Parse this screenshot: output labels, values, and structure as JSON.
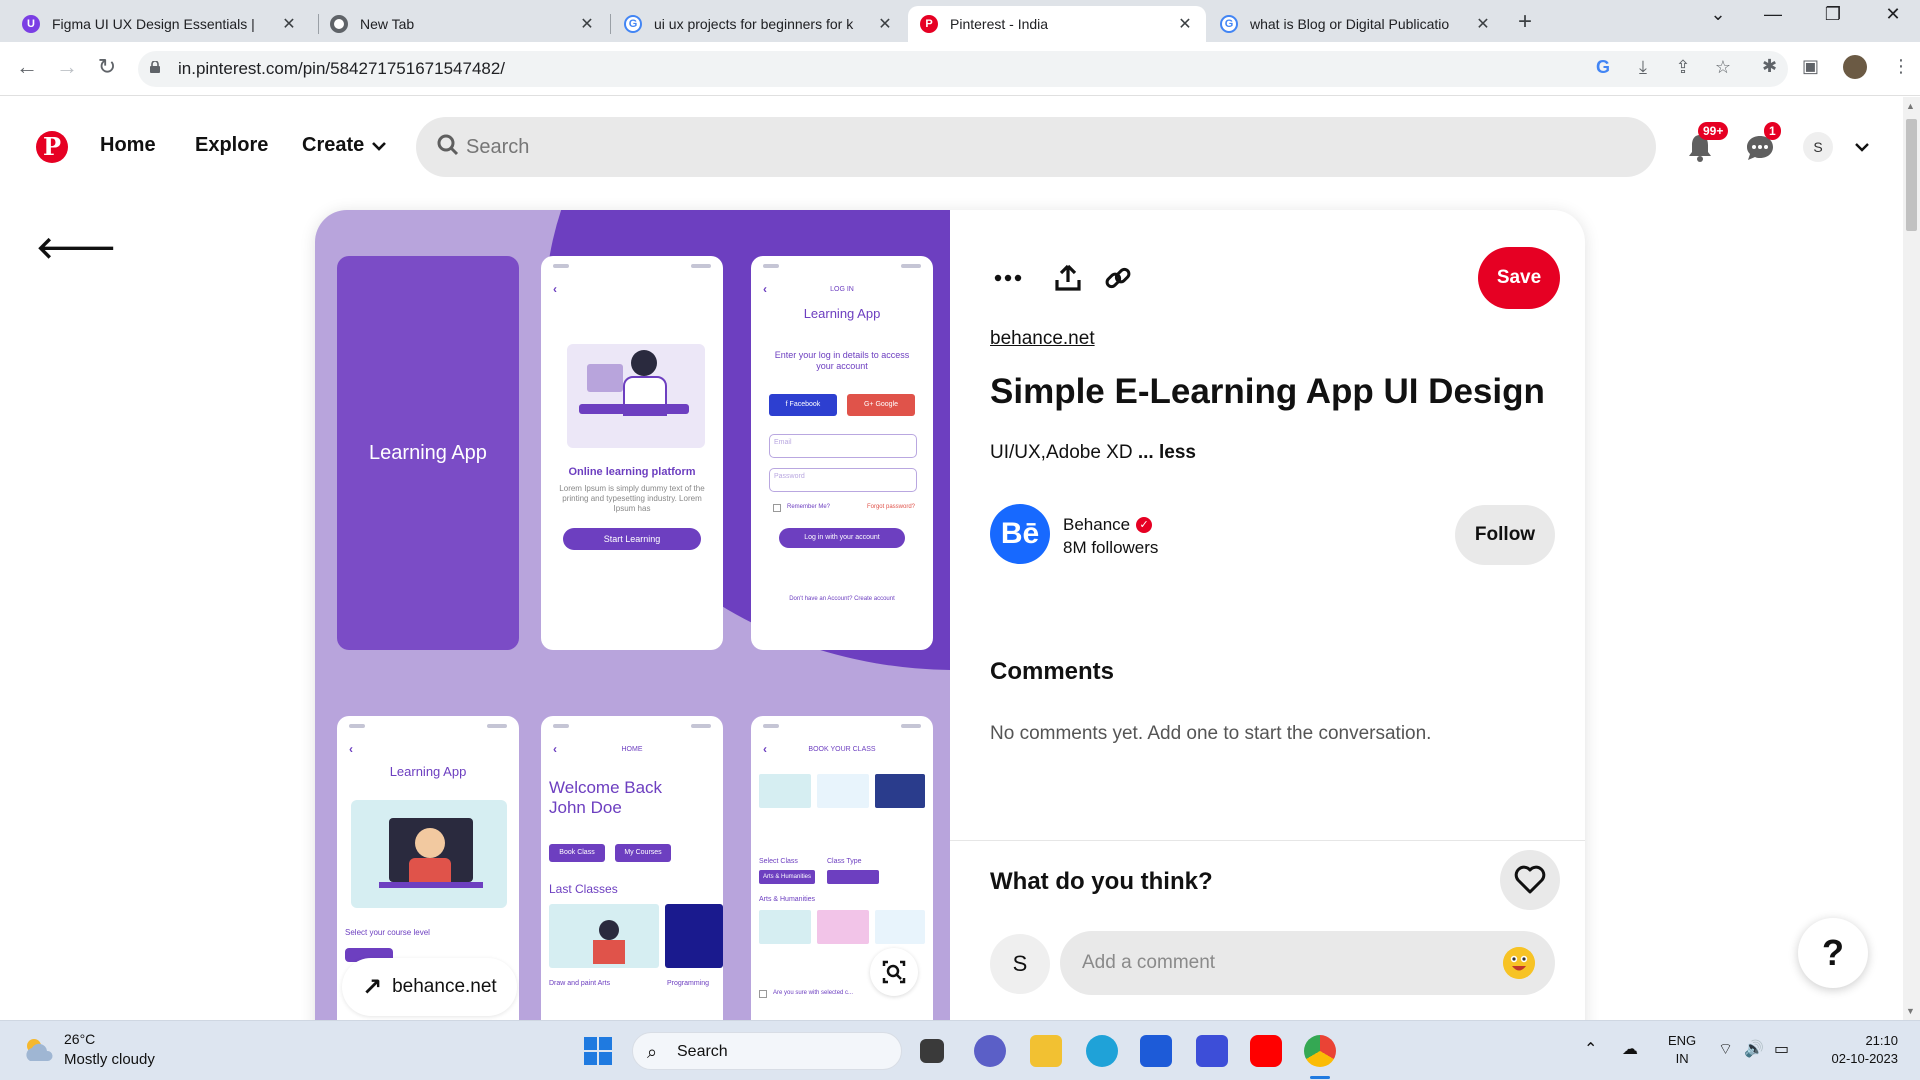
{
  "browser": {
    "tabs": [
      {
        "title": "Figma UI UX Design Essentials |",
        "favicon": "U",
        "color": "#7b3fe4"
      },
      {
        "title": "New Tab",
        "favicon": "chrome",
        "color": "#5f6368"
      },
      {
        "title": "ui ux projects for beginners for k",
        "favicon": "G",
        "color": "#4285f4"
      },
      {
        "title": "Pinterest - India",
        "favicon": "P",
        "color": "#e60023"
      },
      {
        "title": "what is Blog or Digital Publicatio",
        "favicon": "G",
        "color": "#4285f4"
      }
    ],
    "active_tab_index": 3,
    "url": "in.pinterest.com/pin/584271751671547482/"
  },
  "pinterest_header": {
    "nav": {
      "home": "Home",
      "explore": "Explore",
      "create": "Create"
    },
    "search_placeholder": "Search",
    "notifications_badge": "99+",
    "messages_badge": "1",
    "avatar_initial": "S"
  },
  "pin": {
    "image": {
      "screen1_title": "Learning App",
      "screen2_heading": "Online learning platform",
      "screen2_body": "Lorem Ipsum is simply dummy text of the printing and typesetting industry. Lorem Ipsum has",
      "screen2_button": "Start Learning",
      "screen3_label": "LOG IN",
      "screen3_title": "Learning App",
      "screen3_subtitle": "Enter your log in details to access your account",
      "screen3_facebook": "f  Facebook",
      "screen3_google": "G+ Google",
      "screen3_email": "Email",
      "screen3_password": "Password",
      "screen3_remember": "Remember Me?",
      "screen3_forgot": "Forgot password?",
      "screen3_button": "Log in with your account",
      "screen3_footer": "Don't have an Account? Create account",
      "screen4_title": "Learning App",
      "screen4_level": "Select your course level",
      "screen5_label": "HOME",
      "screen5_welcome": "Welcome Back John Doe",
      "screen5_book": "Book Class",
      "screen5_courses": "My Courses",
      "screen5_last": "Last Classes",
      "screen5_card1": "Draw and paint Arts",
      "screen5_card2": "Programming",
      "screen6_label": "BOOK YOUR CLASS",
      "screen6_select": "Select Class",
      "screen6_type": "Class Type",
      "screen6_arts": "Arts & Humanities",
      "screen6_confirm": "Are you sure with selected c..."
    },
    "source_pill": "behance.net",
    "save_label": "Save",
    "source_link": "behance.net",
    "title": "Simple E-Learning App UI Design",
    "description": "UI/UX,Adobe XD",
    "less_label": "... less",
    "creator": {
      "name": "Behance",
      "followers": "8M followers",
      "avatar_text": "Bē"
    },
    "follow_label": "Follow",
    "comments_heading": "Comments",
    "no_comments": "No comments yet. Add one to start the conversation.",
    "what_do_you_think": "What do you think?",
    "comment_avatar": "S",
    "comment_placeholder": "Add a comment"
  },
  "help_label": "?",
  "taskbar": {
    "weather_temp": "26°C",
    "weather_desc": "Mostly cloudy",
    "search_label": "Search",
    "lang_line1": "ENG",
    "lang_line2": "IN",
    "time": "21:10",
    "date": "02-10-2023"
  }
}
